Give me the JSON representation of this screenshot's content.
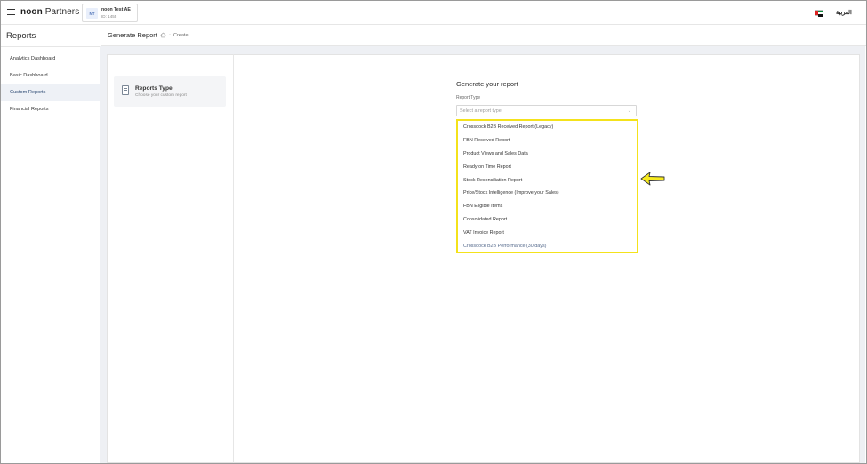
{
  "topbar": {
    "brand_bold": "noon",
    "brand_rest": "Partners",
    "store_badge": "NT",
    "store_name": "noon Test AE",
    "store_id": "ID: 1455",
    "language_toggle": "العربية"
  },
  "sidebar": {
    "title": "Reports",
    "items": [
      {
        "label": "Analytics Dashboard"
      },
      {
        "label": "Basic Dashboard"
      },
      {
        "label": "Custom Reports"
      },
      {
        "label": "Financial Reports"
      }
    ]
  },
  "header": {
    "title": "Generate Report",
    "breadcrumb_current": "Create"
  },
  "left_panel": {
    "reports_type_title": "Reports Type",
    "reports_type_subtitle": "Choose your custom report"
  },
  "form": {
    "heading": "Generate your report",
    "field_label": "Report Type",
    "select_placeholder": "Select a report type",
    "options": [
      "Crossdock B2B Received Report (Legacy)",
      "FBN Received Report",
      "Product Views and Sales Data",
      "Ready on Time Report",
      "Stock Reconciliation Report",
      "Price/Stock Intelligence (Improve your Sales)",
      "FBN Eligible Items",
      "Consolidated Report",
      "VAT Invoice Report",
      "Crossdock B2B Performance (30 days)"
    ]
  },
  "colors": {
    "highlight": "#f4e21b",
    "active_nav_bg": "#eef1f6",
    "page_bg": "#eef0f4"
  },
  "icons": {
    "menu": "hamburger-icon",
    "home": "home-icon",
    "report": "report-document-icon",
    "select": "chevron-down-icon",
    "annotation": "pointer-arrow-icon"
  }
}
